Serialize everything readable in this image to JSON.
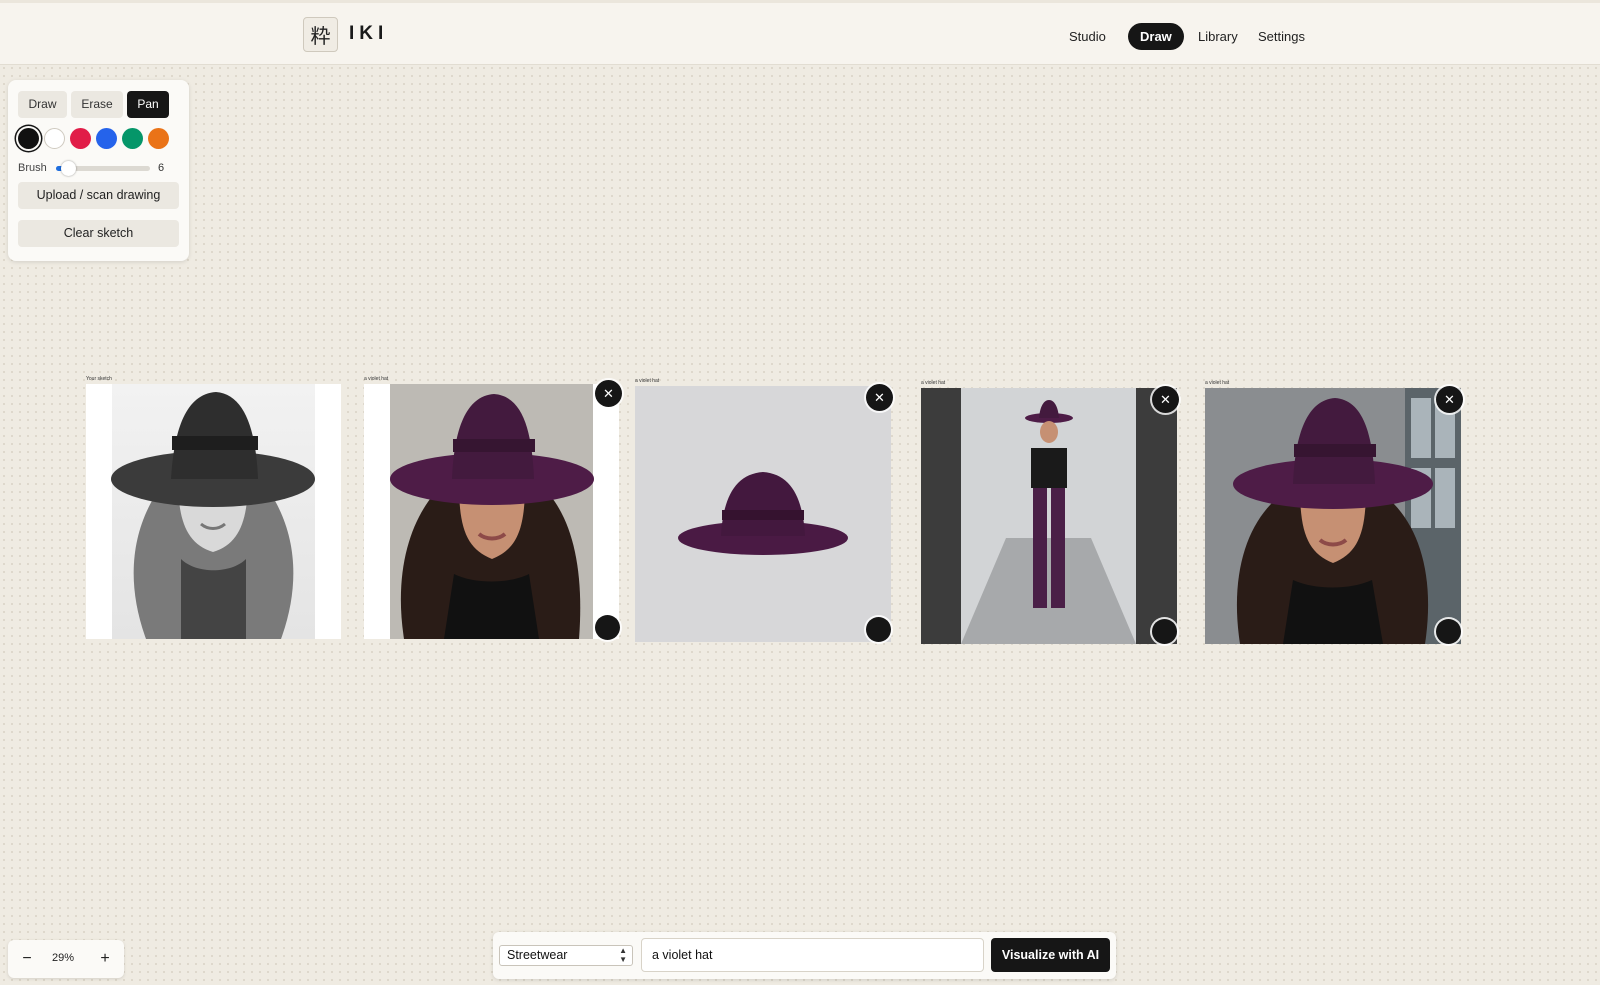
{
  "header": {
    "logo_glyph": "粋",
    "brand": "IKI",
    "nav": [
      {
        "label": "Studio"
      },
      {
        "label": "Draw",
        "active": true
      },
      {
        "label": "Library"
      },
      {
        "label": "Settings"
      }
    ]
  },
  "tools": {
    "modes": [
      "Draw",
      "Erase",
      "Pan"
    ],
    "active_mode": "Pan",
    "colors": [
      "#111111",
      "#ffffff",
      "#e11d48",
      "#2563eb",
      "#059669",
      "#ea7317"
    ],
    "selected_color": "#111111",
    "brush_label": "Brush",
    "brush_value": "6",
    "brush_fraction": 0.13,
    "upload_label": "Upload / scan drawing",
    "clear_label": "Clear sketch"
  },
  "cards": [
    {
      "caption": "Your sketch",
      "kind": "sketch"
    },
    {
      "caption": "a violet hat",
      "kind": "portrait"
    },
    {
      "caption": "a violet hat",
      "kind": "product"
    },
    {
      "caption": "a violet hat",
      "kind": "runway"
    },
    {
      "caption": "a violet hat",
      "kind": "street"
    }
  ],
  "zoom": {
    "minus": "−",
    "value": "29%",
    "plus": "+"
  },
  "prompt": {
    "style": "Streetwear",
    "text": "a violet hat",
    "submit_label": "Visualize with AI"
  },
  "colors": {
    "accent": "#161616",
    "hat": "#4e1c47",
    "canvas": "#efebe2"
  }
}
